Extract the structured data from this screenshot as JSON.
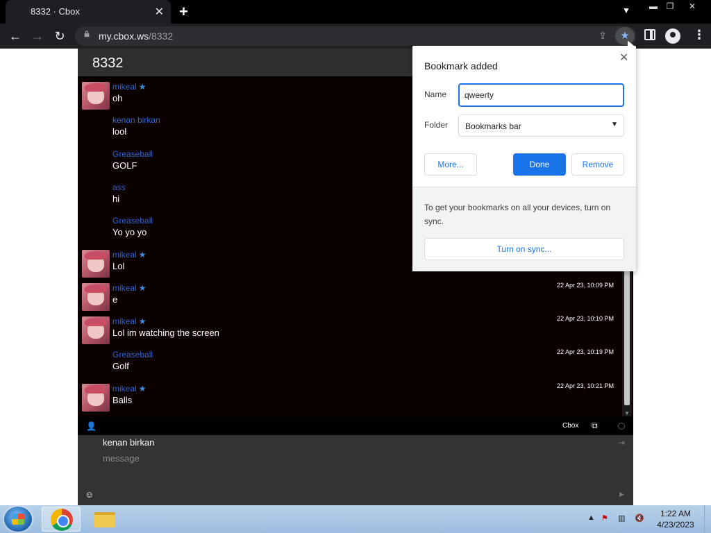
{
  "browser": {
    "tab_title": "8332 · Cbox",
    "tab_close": "✕",
    "new_tab": "+",
    "url_domain": "my.cbox.ws",
    "url_path": "/8332"
  },
  "cbox": {
    "title": "8332",
    "messages": [
      {
        "user": "mikeal",
        "starred": true,
        "has_avatar": true,
        "text": "oh",
        "time": ""
      },
      {
        "user": "kenan birkan",
        "starred": false,
        "has_avatar": false,
        "text": "lool",
        "time": ""
      },
      {
        "user": "Greaseball",
        "starred": false,
        "has_avatar": false,
        "text": "GOLF",
        "time": ""
      },
      {
        "user": "ass",
        "starred": false,
        "has_avatar": false,
        "text": "hi",
        "time": ""
      },
      {
        "user": "Greaseball",
        "starred": false,
        "has_avatar": false,
        "text": "Yo yo yo",
        "time": ""
      },
      {
        "user": "mikeal",
        "starred": true,
        "has_avatar": true,
        "text": "Lol",
        "time": ""
      },
      {
        "user": "mikeal",
        "starred": true,
        "has_avatar": true,
        "text": "e",
        "time": "22 Apr 23, 10:09 PM"
      },
      {
        "user": "mikeal",
        "starred": true,
        "has_avatar": true,
        "text": "Lol im watching the screen",
        "time": "22 Apr 23, 10:10 PM"
      },
      {
        "user": "Greaseball",
        "starred": false,
        "has_avatar": false,
        "text": "Golf",
        "time": "22 Apr 23, 10:19 PM"
      },
      {
        "user": "mikeal",
        "starred": true,
        "has_avatar": true,
        "text": "Balls",
        "time": "22 Apr 23, 10:21 PM"
      }
    ],
    "footer_label": "Cbox",
    "compose_name": "kenan birkan",
    "compose_placeholder": "message"
  },
  "bookmark_popup": {
    "title": "Bookmark added",
    "close": "✕",
    "name_label": "Name",
    "name_value": "qweerty",
    "folder_label": "Folder",
    "folder_value": "Bookmarks bar",
    "more_label": "More...",
    "done_label": "Done",
    "remove_label": "Remove",
    "sync_text": "To get your bookmarks on all your devices, turn on sync.",
    "sync_button": "Turn on sync..."
  },
  "taskbar": {
    "time": "1:22 AM",
    "date": "4/23/2023"
  },
  "colors": {
    "accent_blue": "#1a73e8",
    "username_blue": "#2e66d8"
  }
}
